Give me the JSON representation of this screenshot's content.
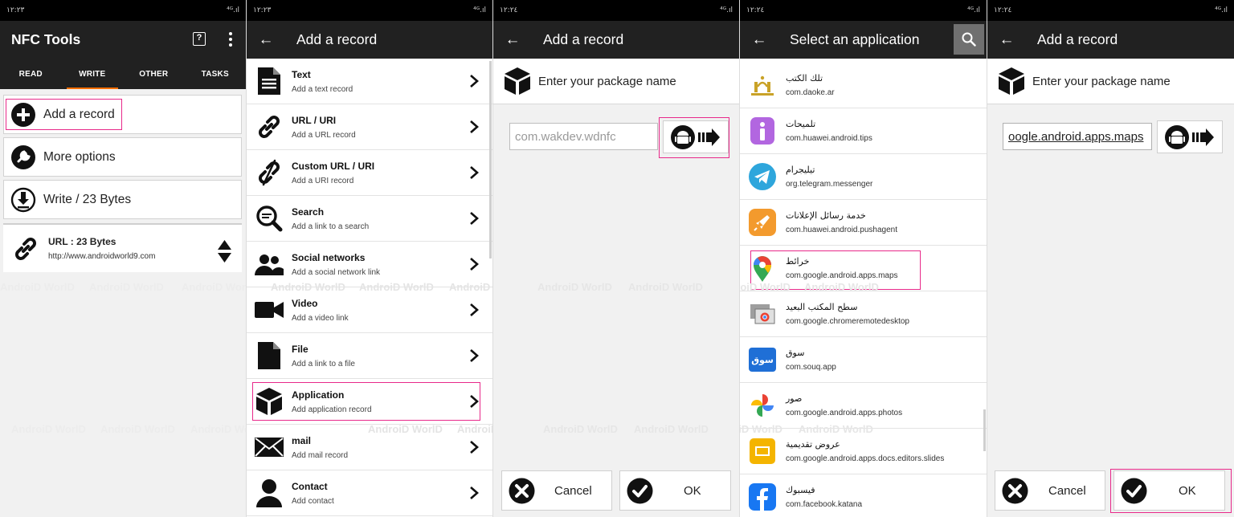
{
  "status_bar": {
    "time": "١٢:٢٣",
    "time2": "١٢:٢٤",
    "signal": "⁴ᴳ.ıl"
  },
  "panel1": {
    "title": "NFC Tools",
    "tabs": [
      "READ",
      "WRITE",
      "OTHER",
      "TASKS"
    ],
    "buttons": {
      "add_record": "Add a record",
      "more_options": "More options",
      "write": "Write / 23 Bytes"
    },
    "url_record": {
      "title": "URL : 23 Bytes",
      "value": "http://www.androidworld9.com"
    }
  },
  "panel2": {
    "title": "Add a record",
    "records": [
      {
        "title": "Text",
        "sub": "Add a text record"
      },
      {
        "title": "URL / URI",
        "sub": "Add a URL record"
      },
      {
        "title": "Custom URL / URI",
        "sub": "Add a URI record"
      },
      {
        "title": "Search",
        "sub": "Add a link to a search"
      },
      {
        "title": "Social networks",
        "sub": "Add a social network link"
      },
      {
        "title": "Video",
        "sub": "Add a video link"
      },
      {
        "title": "File",
        "sub": "Add a link to a file"
      },
      {
        "title": "Application",
        "sub": "Add application record"
      },
      {
        "title": "mail",
        "sub": "Add mail record"
      },
      {
        "title": "Contact",
        "sub": "Add contact"
      }
    ]
  },
  "panel3": {
    "title": "Add a record",
    "package_label": "Enter your package name",
    "package_placeholder": "com.wakdev.wdnfc",
    "cancel": "Cancel",
    "ok": "OK"
  },
  "panel4": {
    "title": "Select an application",
    "apps": [
      {
        "name": "تلك الكتب",
        "pkg": "com.daoke.ar"
      },
      {
        "name": "تلميحات",
        "pkg": "com.huawei.android.tips"
      },
      {
        "name": "تيليجرام",
        "pkg": "org.telegram.messenger"
      },
      {
        "name": "خدمة رسائل الإعلانات",
        "pkg": "com.huawei.android.pushagent"
      },
      {
        "name": "خرائط",
        "pkg": "com.google.android.apps.maps"
      },
      {
        "name": "سطح المكتب البعيد",
        "pkg": "com.google.chromeremotedesktop"
      },
      {
        "name": "سوق",
        "pkg": "com.souq.app"
      },
      {
        "name": "صور",
        "pkg": "com.google.android.apps.photos"
      },
      {
        "name": "عروض تقديمية",
        "pkg": "com.google.android.apps.docs.editors.slides"
      },
      {
        "name": "فيسبوك",
        "pkg": "com.facebook.katana"
      }
    ]
  },
  "panel5": {
    "title": "Add a record",
    "package_label": "Enter your package name",
    "package_value": "oogle.android.apps.maps",
    "cancel": "Cancel",
    "ok": "OK"
  },
  "watermark": {
    "text": "AndroiD WorlD"
  },
  "colors": {
    "appbar": "#212121",
    "tab_indicator": "#ff6f00",
    "highlight": "#e8298a"
  },
  "icons": [
    "help-icon",
    "kebab-icon",
    "add-circle-icon",
    "wrench-icon",
    "download-icon",
    "link-icon",
    "sort-icon",
    "back-arrow-icon",
    "search-icon",
    "text-file-icon",
    "link-icon",
    "broken-link-icon",
    "magnifier-icon",
    "people-icon",
    "video-camera-icon",
    "file-icon",
    "cube-icon",
    "mail-icon",
    "contact-icon",
    "chevron-right-icon",
    "android-icon",
    "close-circle-icon",
    "check-circle-icon"
  ]
}
